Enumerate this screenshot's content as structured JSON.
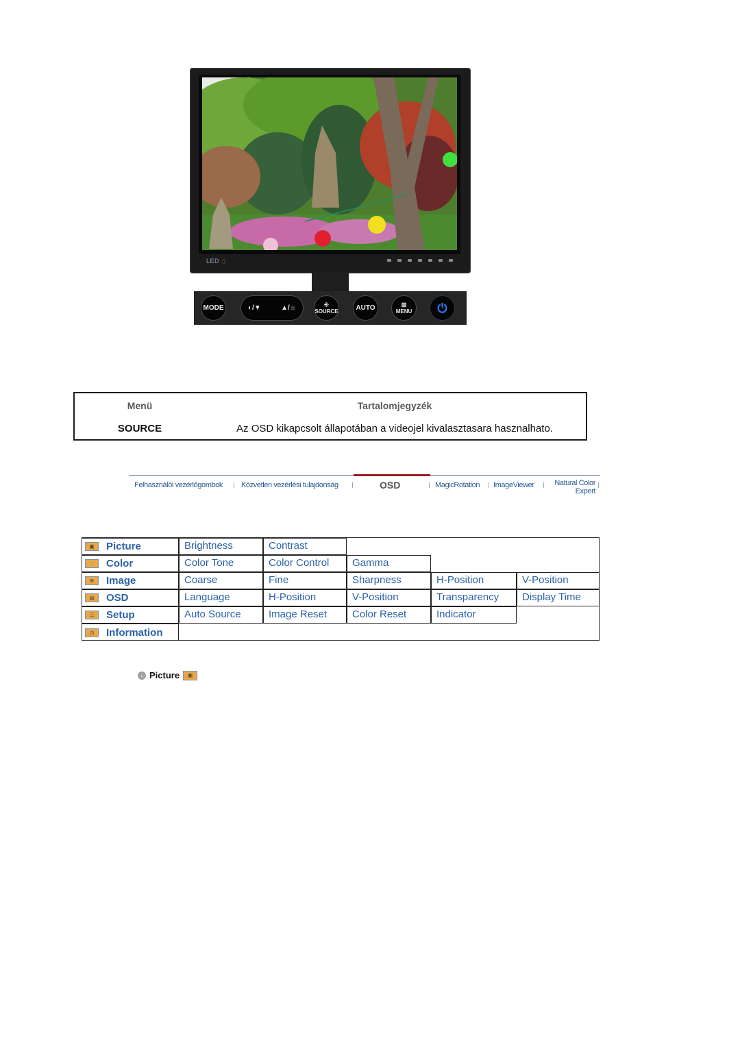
{
  "monitor": {
    "led_label": "LED",
    "buttons": {
      "mode": "MODE",
      "brightness_down": "◐/▼",
      "brightness_up": "▲/☼",
      "source": "SOURCE",
      "auto": "AUTO",
      "menu": "MENU",
      "power_icon": "power-icon"
    }
  },
  "info_table": {
    "header_menu": "Menü",
    "header_contents": "Tartalomjegyzék",
    "row_menu": "SOURCE",
    "row_description": "Az OSD kikapcsolt állapotában a videojel kivalasztasara hasznalhato."
  },
  "nav": {
    "items": [
      {
        "label": "Felhasználói vezérlőgombok"
      },
      {
        "label": "Közvetlen vezérlési tulajdonság"
      },
      {
        "label": "OSD",
        "active": true
      },
      {
        "label": "MagicRotation"
      },
      {
        "label": "ImageViewer"
      },
      {
        "label": "Natural Color",
        "label2": "Expert"
      }
    ],
    "active_color": "#9a1e22",
    "link_color": "#2a5a94"
  },
  "osd_menu": {
    "categories": [
      {
        "label": "Picture",
        "icon": "picture-icon",
        "items": [
          "Brightness",
          "Contrast"
        ]
      },
      {
        "label": "Color",
        "icon": "color-icon",
        "items": [
          "Color Tone",
          "Color Control",
          "Gamma"
        ]
      },
      {
        "label": "Image",
        "icon": "image-icon",
        "items": [
          "Coarse",
          "Fine",
          "Sharpness",
          "H-Position",
          "V-Position"
        ]
      },
      {
        "label": "OSD",
        "icon": "osd-icon",
        "items": [
          "Language",
          "H-Position",
          "V-Position",
          "Transparency",
          "Display Time"
        ]
      },
      {
        "label": "Setup",
        "icon": "setup-icon",
        "items": [
          "Auto Source",
          "Image Reset",
          "Color Reset",
          "Indicator"
        ]
      },
      {
        "label": "Information",
        "icon": "information-icon",
        "items": []
      }
    ],
    "text_color": "#2b62a8"
  },
  "picture_link": {
    "label": "Picture"
  }
}
